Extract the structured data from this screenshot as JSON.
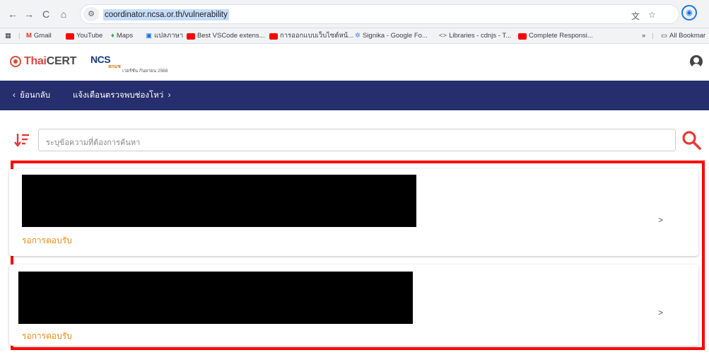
{
  "browser": {
    "url": "coordinator.ncsa.or.th/vulnerability",
    "bookmarks": [
      {
        "label": "Gmail",
        "icon": "gmail-icon"
      },
      {
        "label": "YouTube",
        "icon": "youtube-icon"
      },
      {
        "label": "Maps",
        "icon": "maps-icon"
      },
      {
        "label": "แปลภาษา",
        "icon": "translate-icon"
      },
      {
        "label": "Best VSCode extens...",
        "icon": "youtube-icon"
      },
      {
        "label": "การออกแบบเว็บไซต์หน้...",
        "icon": "youtube-icon"
      },
      {
        "label": "Signika - Google Fo...",
        "icon": "google-fonts-icon"
      },
      {
        "label": "Libraries - cdnjs - T...",
        "icon": "code-icon"
      },
      {
        "label": "Complete Responsi...",
        "icon": "youtube-icon"
      }
    ],
    "overflow_label": "»",
    "all_bookmarks_label": "All Bookmar"
  },
  "header": {
    "logo_brand_a": "Thai",
    "logo_brand_b": "CERT",
    "ncsa_logo": "NCS",
    "ncsa_sub": "สกมช",
    "version": "เวอร์ชัน กันยายน 2568"
  },
  "navbar": {
    "back_label": "ย้อนกลับ",
    "back_icon": "chevron-left-icon",
    "crumb_label": "แจ้งเตือนตรวจพบช่องโหว่",
    "crumb_icon": "chevron-right-icon"
  },
  "search": {
    "placeholder": "ระบุข้อความที่ต้องการค้นหา"
  },
  "items": [
    {
      "status": "รอการตอบรับ",
      "chevron": ">"
    },
    {
      "status": "รอการตอบรับ",
      "chevron": ">"
    }
  ],
  "colors": {
    "navbar_bg": "#262e6e",
    "status": "#ef8c14",
    "accent_red": "#e53935",
    "highlight_frame": "#ff0000"
  }
}
